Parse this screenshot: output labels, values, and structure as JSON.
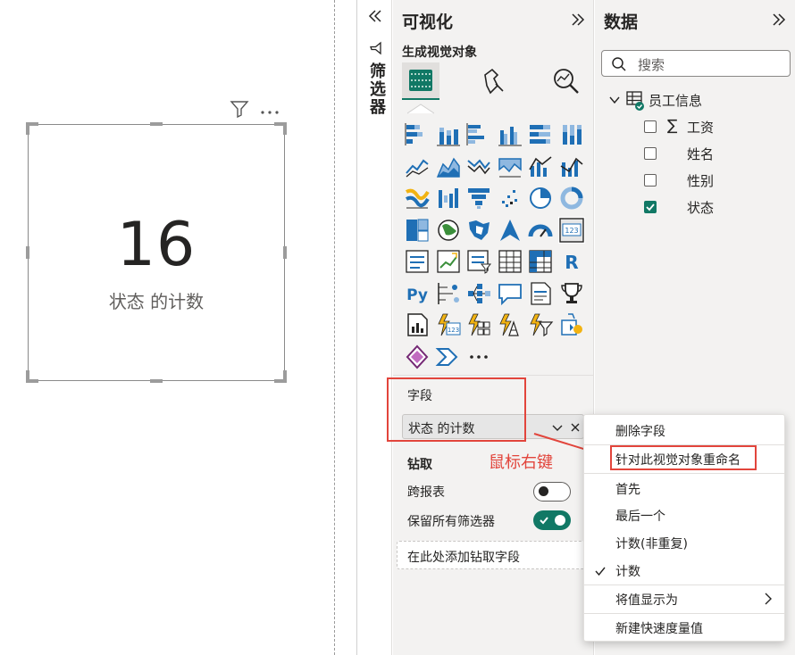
{
  "visual": {
    "kpi_value": "16",
    "kpi_label": "状态 的计数"
  },
  "filters": {
    "title": "筛选器"
  },
  "visualizations": {
    "title": "可视化",
    "subtitle": "生成视觉对象",
    "fields_label": "字段",
    "field_value": "状态 的计数",
    "drill_label": "钻取",
    "cross_report_label": "跨报表",
    "cross_report_on": false,
    "keep_filters_label": "保留所有筛选器",
    "keep_filters_on": true,
    "drill_drop_placeholder": "在此处添加钻取字段",
    "accent": "#117865"
  },
  "data": {
    "title": "数据",
    "search_placeholder": "搜索",
    "table_name": "员工信息",
    "fields": [
      {
        "name": "工资",
        "checked": false,
        "sigma": true
      },
      {
        "name": "姓名",
        "checked": false,
        "sigma": false
      },
      {
        "name": "性别",
        "checked": false,
        "sigma": false
      },
      {
        "name": "状态",
        "checked": true,
        "sigma": false
      }
    ]
  },
  "context_menu": {
    "items": [
      "删除字段",
      "针对此视觉对象重命名",
      "首先",
      "最后一个",
      "计数(非重复)",
      "计数",
      "将值显示为",
      "新建快速度量值"
    ],
    "checked_item": "计数"
  },
  "annotation": {
    "text": "鼠标右键",
    "color": "#e2453c"
  },
  "icons": {
    "collapse_left": "double-chevron-left-icon",
    "expand_right": "double-chevron-right-icon",
    "filter": "filter-icon",
    "more": "more-options-icon",
    "search": "search-icon",
    "table": "table-icon",
    "sigma": "sigma-icon",
    "check": "checkmark-icon",
    "chevron_right": "chevron-right-icon"
  }
}
